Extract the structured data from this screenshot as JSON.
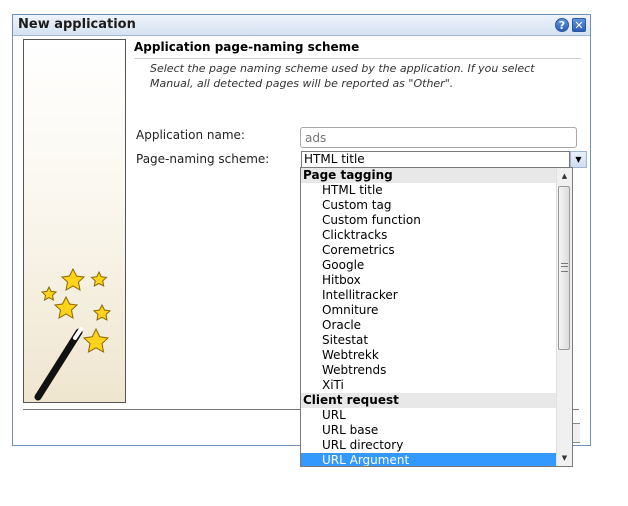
{
  "window": {
    "title": "New application",
    "help_glyph": "?",
    "close_glyph": "✕"
  },
  "section": {
    "heading": "Application page-naming scheme",
    "description": "Select the page naming scheme used by the application. If you select Manual, all detected pages will be reported as \"Other\"."
  },
  "form": {
    "app_name_label": "Application name:",
    "app_name_placeholder": "ads",
    "scheme_label": "Page-naming scheme:",
    "scheme_value": "HTML title"
  },
  "dropdown": {
    "groups": [
      {
        "label": "Page tagging",
        "options": [
          "HTML title",
          "Custom tag",
          "Custom function",
          "Clicktracks",
          "Coremetrics",
          "Google",
          "Hitbox",
          "Intellitracker",
          "Omniture",
          "Oracle",
          "Sitestat",
          "Webtrekk",
          "Webtrends",
          "XiTi"
        ]
      },
      {
        "label": "Client request",
        "options": [
          "URL",
          "URL base",
          "URL directory",
          "URL Argument"
        ]
      }
    ],
    "highlighted_option": "URL Argument",
    "highlight_color": "#3399ff"
  },
  "icons": {
    "wizard": "magic-wand-stars-icon",
    "dropdown_arrow": "chevron-down-icon"
  }
}
